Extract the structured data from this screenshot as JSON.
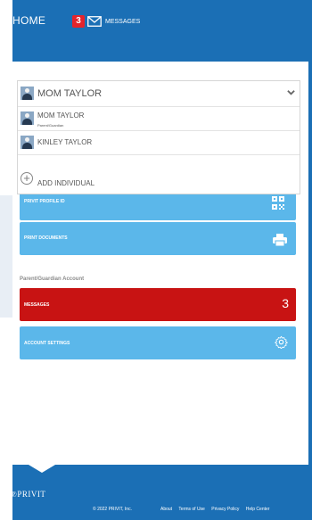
{
  "header": {
    "home_label": "HOME",
    "message_count": "3",
    "messages_label": "MESSAGES"
  },
  "dropdown": {
    "selected_name": "MOM TAYLOR",
    "options": [
      {
        "name": "MOM TAYLOR",
        "role": "Parent/Guardian"
      },
      {
        "name": "KINLEY TAYLOR",
        "role": ""
      }
    ],
    "add_label": "ADD INDIVIDUAL"
  },
  "buttons": {
    "profile_id": "PRIVIT PROFILE ID",
    "print_documents": "PRINT DOCUMENTS"
  },
  "account": {
    "section_label": "Parent/Guardian Account",
    "messages_label": "MESSAGES",
    "messages_count": "3",
    "settings_label": "ACCOUNT SETTINGS"
  },
  "footer": {
    "logo": "℗PRIVIT",
    "copyright": "© 2022 PRIVIT, Inc.",
    "links": [
      "About",
      "Terms of Use",
      "Privacy Policy",
      "Help Center"
    ]
  },
  "colors": {
    "brand_blue": "#1b6fb5",
    "button_blue": "#5bb7ea",
    "alert_red": "#c81313",
    "badge_red": "#e4242c"
  },
  "icons": [
    "mail-icon",
    "chevron-down-icon",
    "plus-circle-icon",
    "qr-code-icon",
    "printer-icon",
    "gear-icon",
    "avatar-icon"
  ]
}
